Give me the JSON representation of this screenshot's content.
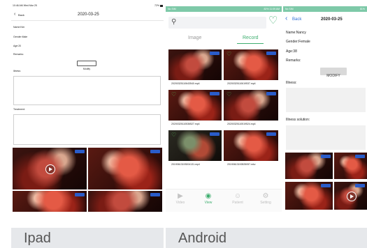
{
  "ipad": {
    "status_time": "10:46 AM  Wed Mar 25",
    "status_right": "72%",
    "back_label": "Back",
    "title": "2020-03-25",
    "name": "Name:Kim",
    "gender": "Gender:Male",
    "age": "Age:20",
    "remarks": "Remarks:",
    "modify": "Modify",
    "illness": "Illness:",
    "treatment": "Treatment:"
  },
  "android_list": {
    "status_left": "No SIM",
    "status_right": "82%  11:09 AM",
    "tabs": [
      "Image",
      "Record"
    ],
    "files": [
      "20200325110643540.mp4",
      "20200325110619537.mp4",
      "20200325110536527.mp4",
      "20200325110519524.mp4",
      "20190613193004131.mp4",
      "20190613192825057.mkv"
    ],
    "nav": [
      "Video",
      "View",
      "Patient",
      "Setting"
    ]
  },
  "android_detail": {
    "status_left": "No SIM",
    "status_right": "81%",
    "back_label": "Back",
    "title": "2020-03-25",
    "name": "Name:Nancy",
    "gender": "Gender:Female",
    "age": "Age:38",
    "remarks": "Remarks:",
    "modify": "MODIFY",
    "illness": "Illness:",
    "illness_solution": "Illness solution:"
  },
  "captions": {
    "left": "Ipad",
    "right": "Android"
  },
  "colors": {
    "accent_blue": "#2f6fd6",
    "accent_green": "#3fae6f",
    "android_status": "#7ec9a8",
    "caption_bg": "#e6e8eb"
  }
}
